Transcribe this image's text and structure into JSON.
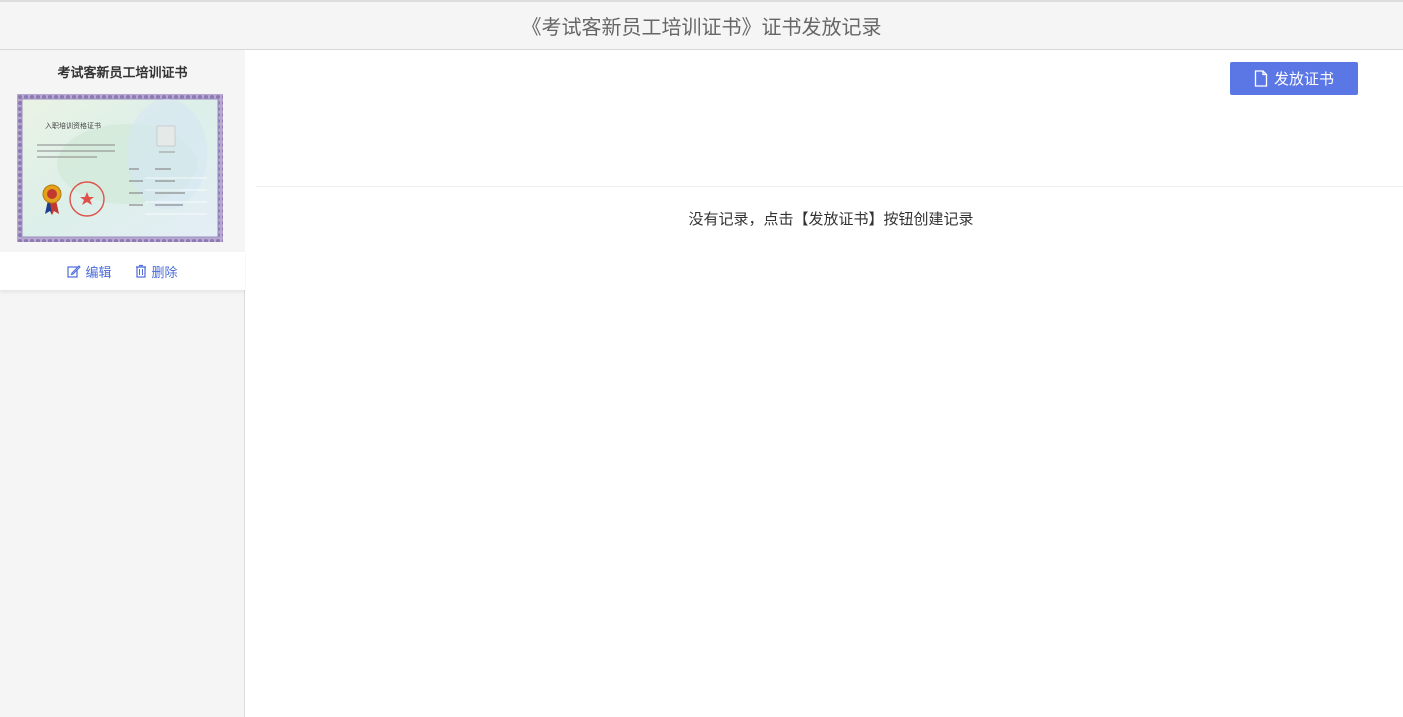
{
  "header": {
    "title": "《考试客新员工培训证书》证书发放记录"
  },
  "sidebar": {
    "certificate": {
      "name": "考试客新员工培训证书",
      "thumbnail": {
        "heading": "入职培训资格证书"
      },
      "actions": {
        "edit_label": "编辑",
        "delete_label": "删除"
      }
    }
  },
  "main": {
    "issue_button_label": "发放证书",
    "empty_message": "没有记录，点击【发放证书】按钮创建记录"
  },
  "colors": {
    "accent": "#5b77e6",
    "link": "#4a6cd9"
  }
}
